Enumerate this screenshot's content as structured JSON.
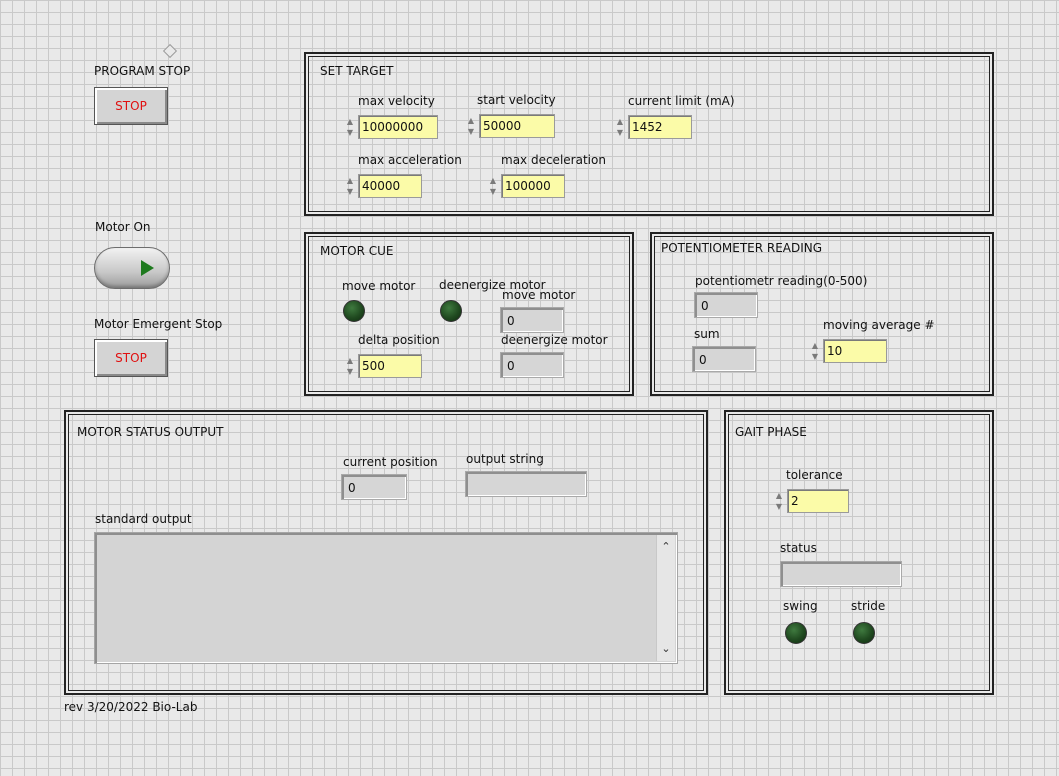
{
  "program_stop": {
    "label": "PROGRAM STOP",
    "button": "STOP"
  },
  "motor_on": {
    "label": "Motor  On"
  },
  "emergent_stop": {
    "label": "Motor Emergent Stop",
    "button": "STOP"
  },
  "set_target": {
    "title": "SET TARGET",
    "max_velocity": {
      "label": "max velocity",
      "value": "10000000"
    },
    "start_velocity": {
      "label": "start velocity",
      "value": "50000"
    },
    "current_limit": {
      "label": "current limit (mA)",
      "value": "1452"
    },
    "max_acceleration": {
      "label": "max acceleration",
      "value": "40000"
    },
    "max_deceleration": {
      "label": "max deceleration",
      "value": "100000"
    }
  },
  "motor_cue": {
    "title": "MOTOR CUE",
    "move_motor_led": {
      "label": "move motor"
    },
    "deenergize_motor_led": {
      "label": "deenergize motor"
    },
    "move_motor_ind": {
      "label": "move motor",
      "value": "0"
    },
    "delta_position": {
      "label": "delta position",
      "value": "500"
    },
    "deenergize_motor_ind": {
      "label": "deenergize motor",
      "value": "0"
    }
  },
  "potentiometer": {
    "title": "POTENTIOMETER READING",
    "reading": {
      "label": "potentiometr reading(0-500)",
      "value": "0"
    },
    "sum": {
      "label": "sum",
      "value": "0"
    },
    "moving_average": {
      "label": "moving average #",
      "value": "10"
    }
  },
  "status_output": {
    "title": "MOTOR STATUS OUTPUT",
    "current_position": {
      "label": "current position",
      "value": "0"
    },
    "output_string": {
      "label": "output string",
      "value": ""
    },
    "standard_output": {
      "label": "standard output",
      "value": ""
    }
  },
  "gait_phase": {
    "title": "GAIT PHASE",
    "tolerance": {
      "label": "tolerance",
      "value": "2"
    },
    "status": {
      "label": "status",
      "value": ""
    },
    "swing": {
      "label": "swing"
    },
    "stride": {
      "label": "stride"
    }
  },
  "footer": {
    "revision": "rev 3/20/2022 Bio-Lab"
  },
  "colors": {
    "control_bg": "#fbfba8",
    "indicator_bg": "#d6d6d6",
    "stop_text": "#e01010",
    "led_off": "#204a20",
    "toggle_arrow": "#1e7a1e"
  }
}
